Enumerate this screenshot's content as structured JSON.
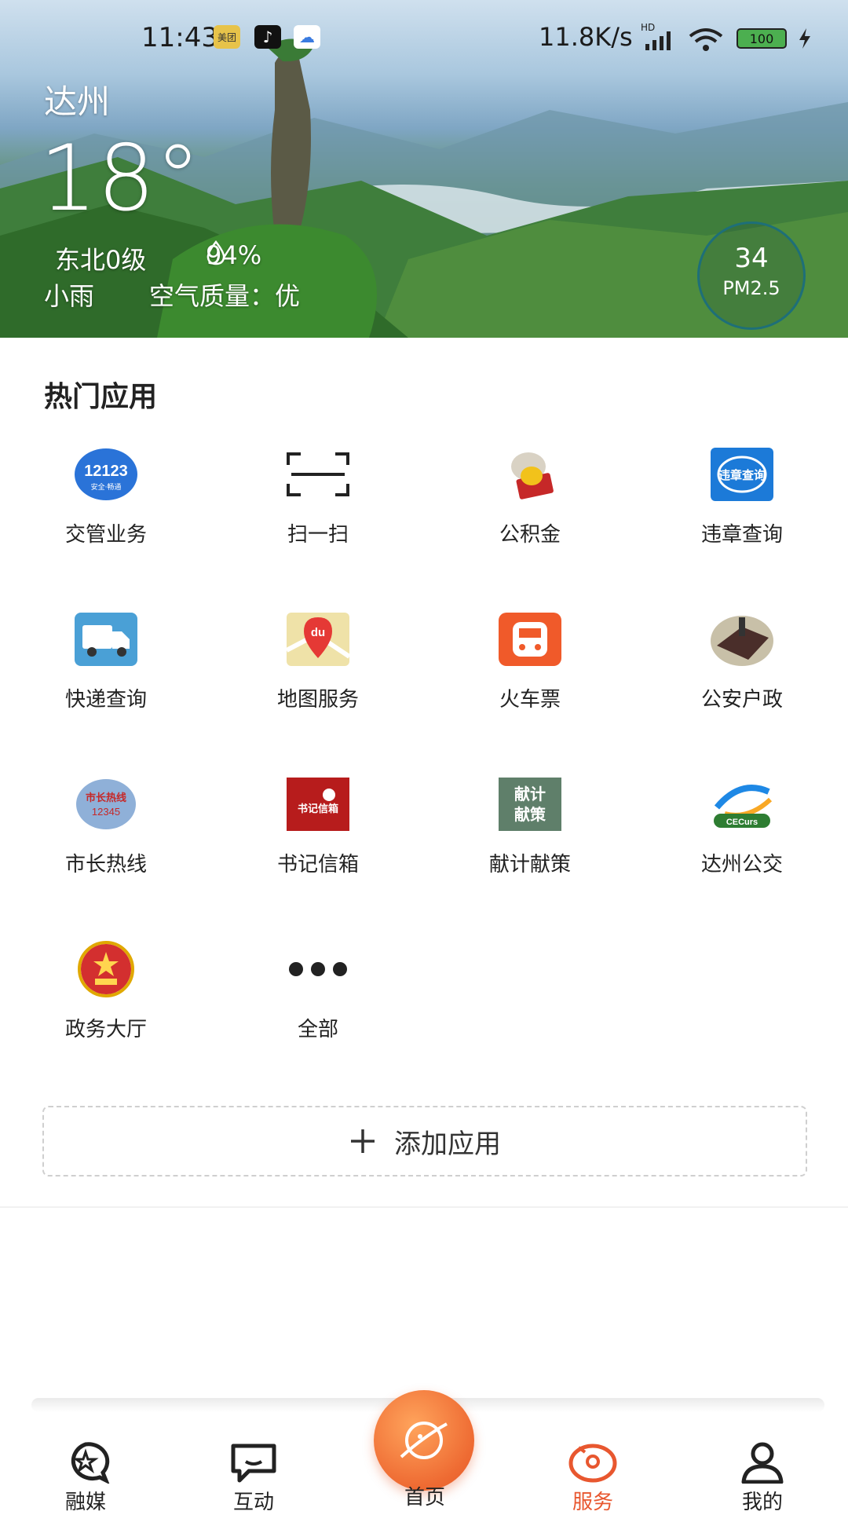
{
  "status_bar": {
    "time": "11:43",
    "badges": [
      "美团",
      "♪",
      "☁"
    ],
    "net_speed": "11.8K/s",
    "signal": "HD",
    "battery": "100"
  },
  "weather": {
    "city": "达州",
    "temperature": "18°",
    "wind": "东北0级",
    "humidity": "94%",
    "condition": "小雨",
    "air_quality": "空气质量：优",
    "pm_value": "34",
    "pm_label": "PM2.5"
  },
  "hot_apps": {
    "title": "热门应用",
    "items": [
      {
        "label": "交管业务",
        "icon": "traffic-12123-icon"
      },
      {
        "label": "扫一扫",
        "icon": "scan-icon"
      },
      {
        "label": "公积金",
        "icon": "housing-fund-icon"
      },
      {
        "label": "违章查询",
        "icon": "violation-query-icon"
      },
      {
        "label": "快递查询",
        "icon": "express-truck-icon"
      },
      {
        "label": "地图服务",
        "icon": "map-icon"
      },
      {
        "label": "火车票",
        "icon": "train-ticket-icon"
      },
      {
        "label": "公安户政",
        "icon": "police-registry-icon"
      },
      {
        "label": "市长热线",
        "icon": "mayor-hotline-icon"
      },
      {
        "label": "书记信箱",
        "icon": "secretary-mailbox-icon"
      },
      {
        "label": "献计献策",
        "icon": "suggestions-icon"
      },
      {
        "label": "达州公交",
        "icon": "dazhou-bus-icon"
      },
      {
        "label": "政务大厅",
        "icon": "government-hall-icon"
      },
      {
        "label": "全部",
        "icon": "more-icon"
      }
    ],
    "icon_texts": {
      "traffic": "12123",
      "traffic_sub": "安全·畅通",
      "violation": "违章查询",
      "map": "du",
      "mayor": "市长热线",
      "mayor_num": "12345",
      "secretary": "书记信箱",
      "suggest1": "献计",
      "suggest2": "献策",
      "bus": "CECurs"
    }
  },
  "add_app": {
    "label": "添加应用"
  },
  "tabbar": {
    "items": [
      {
        "label": "融媒",
        "icon": "media-star-icon"
      },
      {
        "label": "互动",
        "icon": "chat-icon"
      },
      {
        "label": "首页",
        "icon": "home-planet-icon"
      },
      {
        "label": "服务",
        "icon": "service-icon"
      },
      {
        "label": "我的",
        "icon": "profile-icon"
      }
    ],
    "active": "服务"
  },
  "colors": {
    "accent": "#e8572f",
    "pm_ring": "#1e6f78"
  }
}
